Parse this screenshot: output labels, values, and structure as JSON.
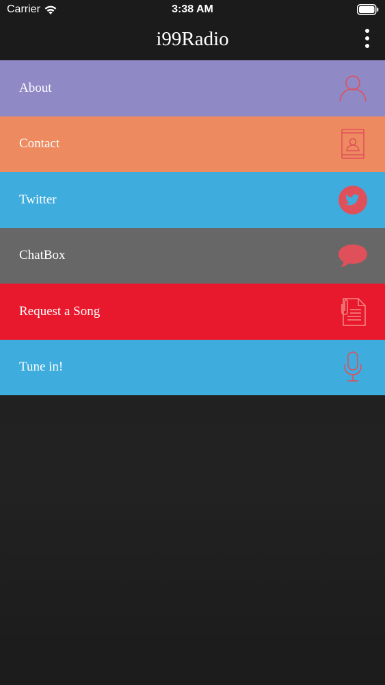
{
  "status_bar": {
    "carrier": "Carrier",
    "time": "3:38 AM",
    "wifi_icon": "wifi-icon",
    "battery_icon": "battery-icon"
  },
  "nav": {
    "title": "i99Radio",
    "menu_icon": "more-vertical-icon"
  },
  "colors": {
    "icon": "#e0505a",
    "about": "#8f89c6",
    "contact": "#ee8a5f",
    "twitter": "#3facde",
    "chatbox": "#676767",
    "request": "#e8192c",
    "tunein": "#3facde"
  },
  "menu": {
    "items": [
      {
        "label": "About",
        "icon": "person-icon"
      },
      {
        "label": "Contact",
        "icon": "contact-book-icon"
      },
      {
        "label": "Twitter",
        "icon": "twitter-icon"
      },
      {
        "label": "ChatBox",
        "icon": "chat-bubble-icon"
      },
      {
        "label": "Request a Song",
        "icon": "document-clip-icon"
      },
      {
        "label": "Tune in!",
        "icon": "microphone-icon"
      }
    ]
  }
}
